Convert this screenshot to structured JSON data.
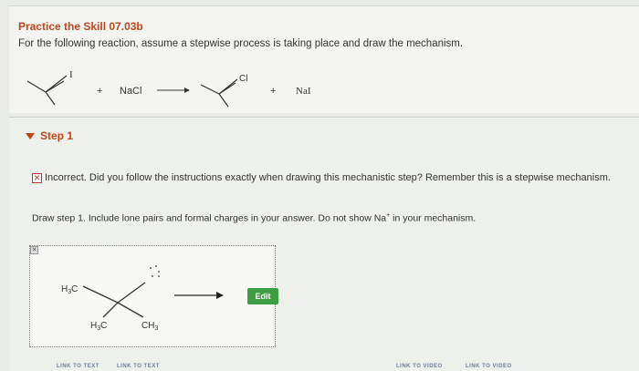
{
  "header": {
    "title": "Practice the Skill 07.03b",
    "instruction": "For the following reaction, assume a stepwise process is taking place and draw the mechanism."
  },
  "reaction": {
    "reactant_label": "I",
    "plus1": "+",
    "reagent": "NaCl",
    "product_label": "Cl",
    "plus2": "+",
    "byproduct": "NaI"
  },
  "step": {
    "label": "Step 1",
    "feedback": "Incorrect. Did you follow the instructions exactly when drawing this mechanistic step? Remember this is a stepwise mechanism.",
    "draw_instruction_pre": "Draw step 1. Include lone pairs and formal charges in your answer. Do not show Na",
    "draw_instruction_sup": "+",
    "draw_instruction_post": " in your mechanism.",
    "edit_label": "Edit"
  },
  "structure": {
    "h3c_left": "H",
    "h3c_left_sub": "3",
    "h3c_left_c": "C",
    "h3c_bottom": "H",
    "h3c_bottom_sub": "3",
    "h3c_bottom_c": "C",
    "ch3": "CH",
    "ch3_sub": "3"
  },
  "links": {
    "link_text_1": "LINK TO TEXT",
    "link_text_2": "LINK TO TEXT",
    "link_video_1": "LINK TO VIDEO",
    "link_video_2": "LINK TO VIDEO"
  },
  "colors": {
    "accent": "#c0451b",
    "edit_button": "#3d9e43",
    "link": "#6b7f99"
  }
}
